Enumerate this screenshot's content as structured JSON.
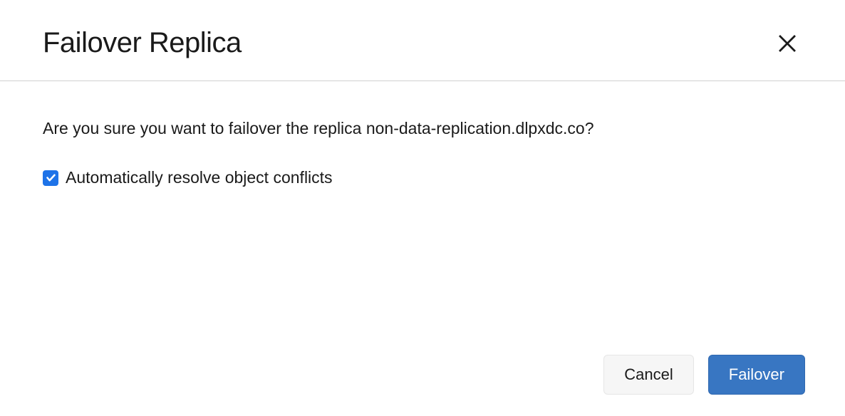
{
  "dialog": {
    "title": "Failover Replica",
    "confirm_text": "Are you sure you want to failover the replica non-data-replication.dlpxdc.co?",
    "checkbox_label": "Automatically resolve object conflicts",
    "cancel_label": "Cancel",
    "primary_label": "Failover"
  }
}
